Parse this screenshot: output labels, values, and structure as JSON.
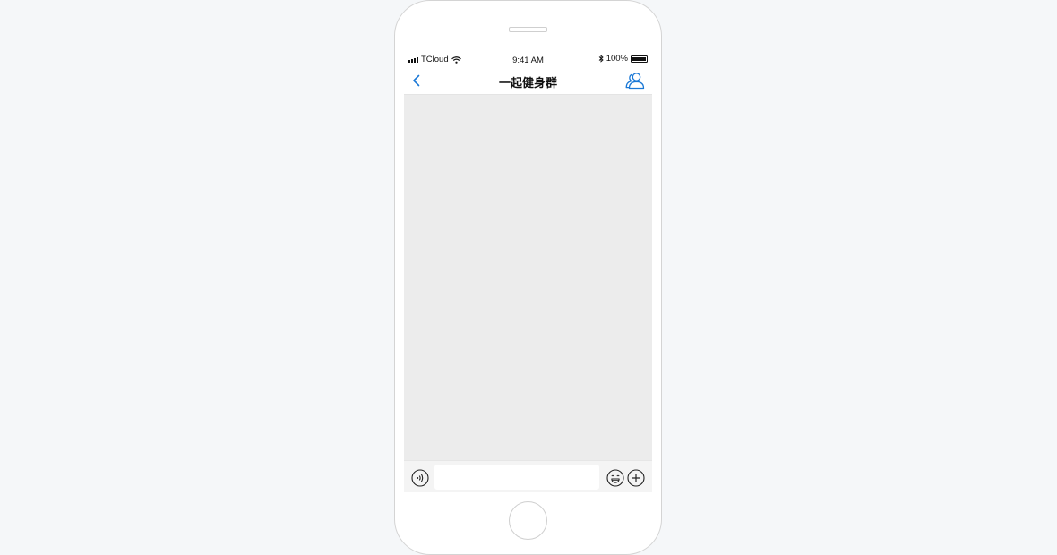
{
  "status_bar": {
    "carrier": "TCloud",
    "time": "9:41 AM",
    "battery": "100%",
    "battery_level": 1.0,
    "icons": [
      "signal-icon",
      "wifi-icon",
      "bluetooth-icon",
      "battery-icon"
    ]
  },
  "nav": {
    "title": "一起健身群",
    "back_icon": "chevron-left-icon",
    "members_icon": "group-members-icon"
  },
  "input_bar": {
    "message_value": "",
    "message_placeholder": "",
    "voice_icon": "voice-icon",
    "emoji_icon": "emoji-icon",
    "plus_icon": "plus-icon"
  },
  "colors": {
    "accent": "#1a78d6",
    "chat_background": "#ececec",
    "page_background": "#f5f7f9"
  }
}
